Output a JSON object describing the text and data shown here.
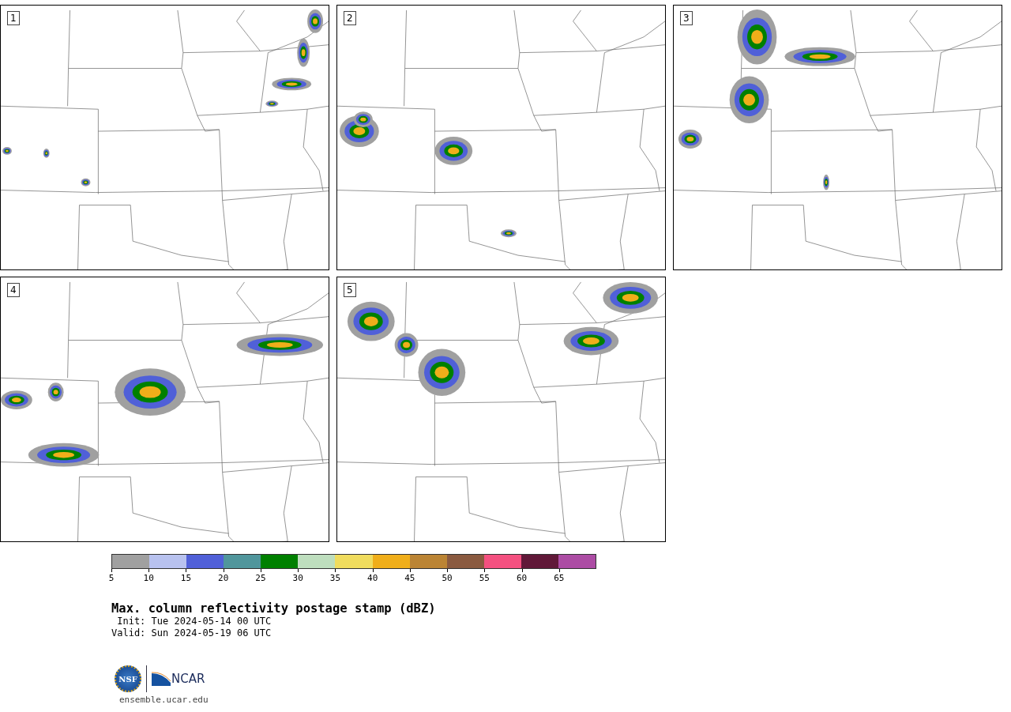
{
  "panels": [
    {
      "label": "1"
    },
    {
      "label": "2"
    },
    {
      "label": "3"
    },
    {
      "label": "4"
    },
    {
      "label": "5"
    }
  ],
  "colorbar": {
    "bins": [
      {
        "label": "5",
        "color": "#a0a0a0"
      },
      {
        "label": "10",
        "color": "#b8c2ef"
      },
      {
        "label": "15",
        "color": "#5060d8"
      },
      {
        "label": "20",
        "color": "#50969c"
      },
      {
        "label": "25",
        "color": "#008000"
      },
      {
        "label": "30",
        "color": "#bedebe"
      },
      {
        "label": "35",
        "color": "#f0dc5e"
      },
      {
        "label": "40",
        "color": "#f0ae1a"
      },
      {
        "label": "45",
        "color": "#bb8434"
      },
      {
        "label": "50",
        "color": "#8a5a40"
      },
      {
        "label": "55",
        "color": "#f45080"
      },
      {
        "label": "60",
        "color": "#601838"
      },
      {
        "label": "65",
        "color": "#ac4ca4"
      }
    ]
  },
  "title": "Max. column reflectivity postage stamp (dBZ)",
  "init": " Init: Tue 2024-05-14 00 UTC",
  "valid": "Valid: Sun 2024-05-19 06 UTC",
  "logos": {
    "left": "NSF",
    "right": "NCAR"
  },
  "url": "ensemble.ucar.edu"
}
